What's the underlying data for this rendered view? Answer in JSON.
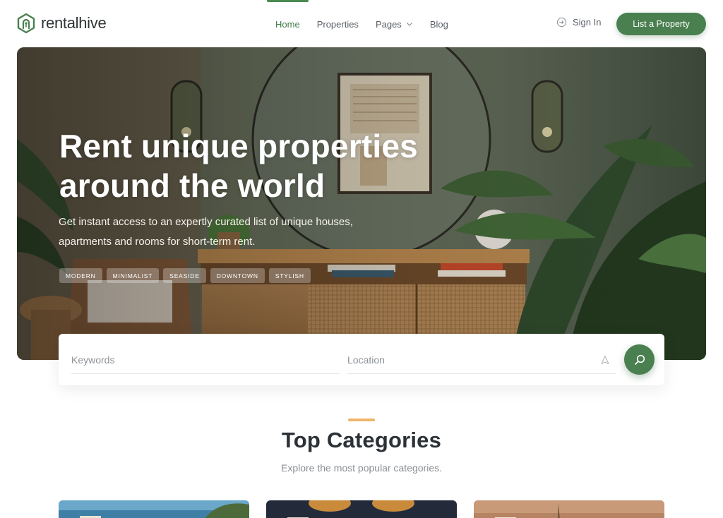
{
  "brand": {
    "name": "rentalhive",
    "accent": "#4a7f50"
  },
  "nav": {
    "items": [
      {
        "label": "Home",
        "active": true
      },
      {
        "label": "Properties",
        "active": false
      },
      {
        "label": "Pages",
        "active": false,
        "has_dropdown": true
      },
      {
        "label": "Blog",
        "active": false
      }
    ],
    "signin_label": "Sign In",
    "cta_label": "List a Property"
  },
  "hero": {
    "title_line1": "Rent unique properties",
    "title_line2": "around the world",
    "subtitle_line1": "Get instant access to an expertly curated list of unique houses,",
    "subtitle_line2": "apartments and rooms for short-term rent.",
    "tags": [
      "MODERN",
      "MINIMALIST",
      "SEASIDE",
      "DOWNTOWN",
      "STYLISH"
    ]
  },
  "search": {
    "keywords_placeholder": "Keywords",
    "location_placeholder": "Location",
    "button_icon": "search-icon"
  },
  "categories": {
    "title": "Top Categories",
    "subtitle": "Explore the most popular categories."
  },
  "colors": {
    "primary": "#4a7f50",
    "accent_line": "#f1b56b"
  }
}
